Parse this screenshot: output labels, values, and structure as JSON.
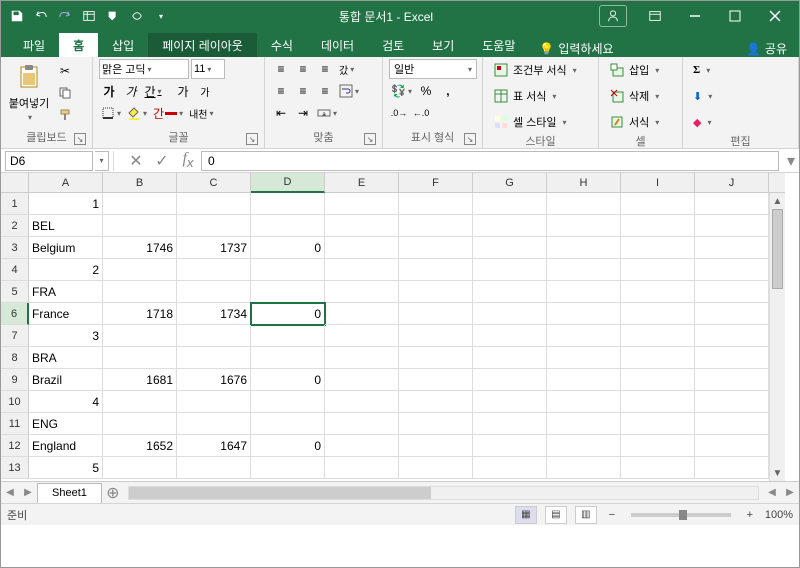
{
  "title": "통합 문서1 - Excel",
  "tabs": {
    "file": "파일",
    "home": "홈",
    "insert": "삽입",
    "pagelayout": "페이지 레이아웃",
    "formulas": "수식",
    "data": "데이터",
    "review": "검토",
    "view": "보기",
    "help": "도움말",
    "tellme": "입력하세요",
    "share": "공유"
  },
  "ribbon": {
    "clipboard": {
      "paste": "붙여넣기",
      "label": "클립보드"
    },
    "font": {
      "name": "맑은 고딕",
      "size": "11",
      "hanja": "내천",
      "label": "글꼴"
    },
    "align": {
      "label": "맞춤"
    },
    "number": {
      "format": "일반",
      "label": "표시 형식"
    },
    "styles": {
      "cond": "조건부 서식",
      "table": "표 서식",
      "cell": "셀 스타일",
      "label": "스타일"
    },
    "cells": {
      "insert": "삽입",
      "delete": "삭제",
      "format": "서식",
      "label": "셀"
    },
    "editing": {
      "label": "편집"
    }
  },
  "formula_bar": {
    "name_box": "D6",
    "value": "0"
  },
  "columns": [
    "A",
    "B",
    "C",
    "D",
    "E",
    "F",
    "G",
    "H",
    "I",
    "J"
  ],
  "rows": [
    "1",
    "2",
    "3",
    "4",
    "5",
    "6",
    "7",
    "8",
    "9",
    "10",
    "11",
    "12",
    "13"
  ],
  "active_col": "D",
  "active_row": "6",
  "cells": {
    "A1": "1",
    "A2": "BEL",
    "A3": "Belgium",
    "B3": "1746",
    "C3": "1737",
    "D3": "0",
    "A4": "2",
    "A5": "FRA",
    "A6": "France",
    "B6": "1718",
    "C6": "1734",
    "D6": "0",
    "A7": "3",
    "A8": "BRA",
    "A9": "Brazil",
    "B9": "1681",
    "C9": "1676",
    "D9": "0",
    "A10": "4",
    "A11": "ENG",
    "A12": "England",
    "B12": "1652",
    "C12": "1647",
    "D12": "0",
    "A13": "5"
  },
  "right_align": [
    "A1",
    "B3",
    "C3",
    "D3",
    "A4",
    "B6",
    "C6",
    "D6",
    "A7",
    "B9",
    "C9",
    "D9",
    "A10",
    "B12",
    "C12",
    "D12",
    "A13"
  ],
  "sheet": {
    "tab1": "Sheet1"
  },
  "status": {
    "ready": "준비",
    "zoom": "100%"
  }
}
